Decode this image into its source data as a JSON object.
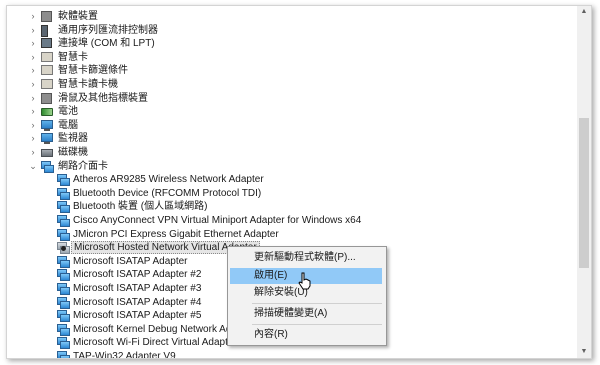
{
  "tree": {
    "items": [
      {
        "label": "軟體裝置",
        "icon": "software-device-icon",
        "kind": "gray",
        "expanded": false
      },
      {
        "label": "通用序列匯流排控制器",
        "icon": "usb-controller-icon",
        "kind": "dev",
        "expanded": false
      },
      {
        "label": "連接埠 (COM 和 LPT)",
        "icon": "port-icon",
        "kind": "chip",
        "expanded": false
      },
      {
        "label": "智慧卡",
        "icon": "smart-card-icon",
        "kind": "card",
        "expanded": false
      },
      {
        "label": "智慧卡篩選條件",
        "icon": "smart-card-filter-icon",
        "kind": "card",
        "expanded": false
      },
      {
        "label": "智慧卡讀卡機",
        "icon": "smart-card-reader-icon",
        "kind": "card",
        "expanded": false
      },
      {
        "label": "滑鼠及其他指標裝置",
        "icon": "mouse-icon",
        "kind": "gray",
        "expanded": false
      },
      {
        "label": "電池",
        "icon": "battery-icon",
        "kind": "batt",
        "expanded": false
      },
      {
        "label": "電腦",
        "icon": "computer-icon",
        "kind": "mon",
        "expanded": false
      },
      {
        "label": "監視器",
        "icon": "monitor-icon",
        "kind": "mon",
        "expanded": false
      },
      {
        "label": "磁碟機",
        "icon": "disk-drive-icon",
        "kind": "disk",
        "expanded": false
      },
      {
        "label": "網路介面卡",
        "icon": "network-adapter-icon",
        "kind": "net",
        "expanded": true
      }
    ],
    "adapters": [
      {
        "label": "Atheros AR9285 Wireless Network Adapter",
        "disabled": false
      },
      {
        "label": "Bluetooth Device (RFCOMM Protocol TDI)",
        "disabled": false
      },
      {
        "label": "Bluetooth 裝置 (個人區域網路)",
        "disabled": false
      },
      {
        "label": "Cisco AnyConnect VPN Virtual Miniport Adapter for Windows x64",
        "disabled": false
      },
      {
        "label": "JMicron PCI Express Gigabit Ethernet Adapter",
        "disabled": false
      },
      {
        "label": "Microsoft Hosted Network Virtual Adapter",
        "disabled": true,
        "selected": true
      },
      {
        "label": "Microsoft ISATAP Adapter",
        "disabled": false
      },
      {
        "label": "Microsoft ISATAP Adapter #2",
        "disabled": false
      },
      {
        "label": "Microsoft ISATAP Adapter #3",
        "disabled": false
      },
      {
        "label": "Microsoft ISATAP Adapter #4",
        "disabled": false
      },
      {
        "label": "Microsoft ISATAP Adapter #5",
        "disabled": false
      },
      {
        "label": "Microsoft Kernel Debug Network Adapter",
        "disabled": false
      },
      {
        "label": "Microsoft Wi-Fi Direct Virtual Adapter",
        "disabled": false
      },
      {
        "label": "TAP-Win32 Adapter V9",
        "disabled": false
      }
    ]
  },
  "context_menu": {
    "items": [
      {
        "label": "更新驅動程式軟體(P)...",
        "highlighted": false
      },
      {
        "label": "啟用(E)",
        "highlighted": true
      },
      {
        "label": "解除安裝(U)",
        "highlighted": false
      },
      {
        "label": "掃描硬體變更(A)",
        "highlighted": false
      },
      {
        "label": "內容(R)",
        "highlighted": false
      }
    ]
  },
  "colors": {
    "menu_highlight": "#91c9f7",
    "selection": "#e5e5e5",
    "icon_blue": "#2c86d3"
  }
}
